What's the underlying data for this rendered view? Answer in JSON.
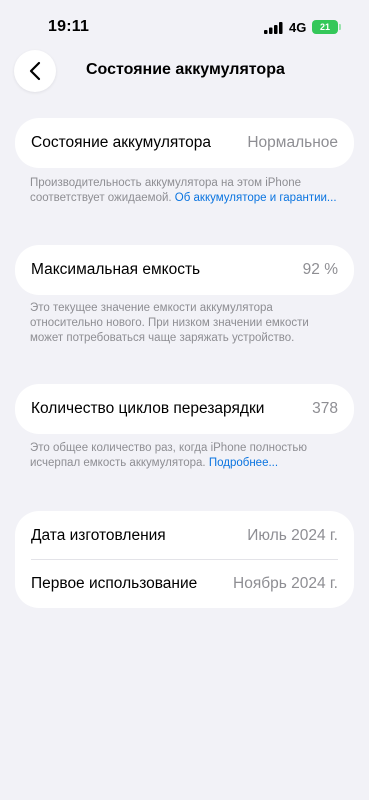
{
  "status": {
    "time": "19:11",
    "network": "4G",
    "battery": "21"
  },
  "nav": {
    "title": "Состояние аккумулятора"
  },
  "health": {
    "label": "Состояние аккумулятора",
    "value": "Нормальное",
    "note_text": "Производительность аккумулятора на этом iPhone соответствует ожидаемой.",
    "note_link": "Об аккумуляторе и гарантии..."
  },
  "capacity": {
    "label": "Максимальная емкость",
    "value": "92 %",
    "note": "Это текущее значение емкости аккумулятора относительно нового. При низком значении емкости может потребоваться чаще заряжать устройство."
  },
  "cycles": {
    "label": "Количество циклов перезарядки",
    "value": "378",
    "note_text": "Это общее количество раз, когда iPhone полностью исчерпал емкость аккумулятора.",
    "note_link": "Подробнее..."
  },
  "dates": {
    "manufacture_label": "Дата изготовления",
    "manufacture_value": "Июль 2024 г.",
    "first_use_label": "Первое использование",
    "first_use_value": "Ноябрь 2024 г."
  }
}
